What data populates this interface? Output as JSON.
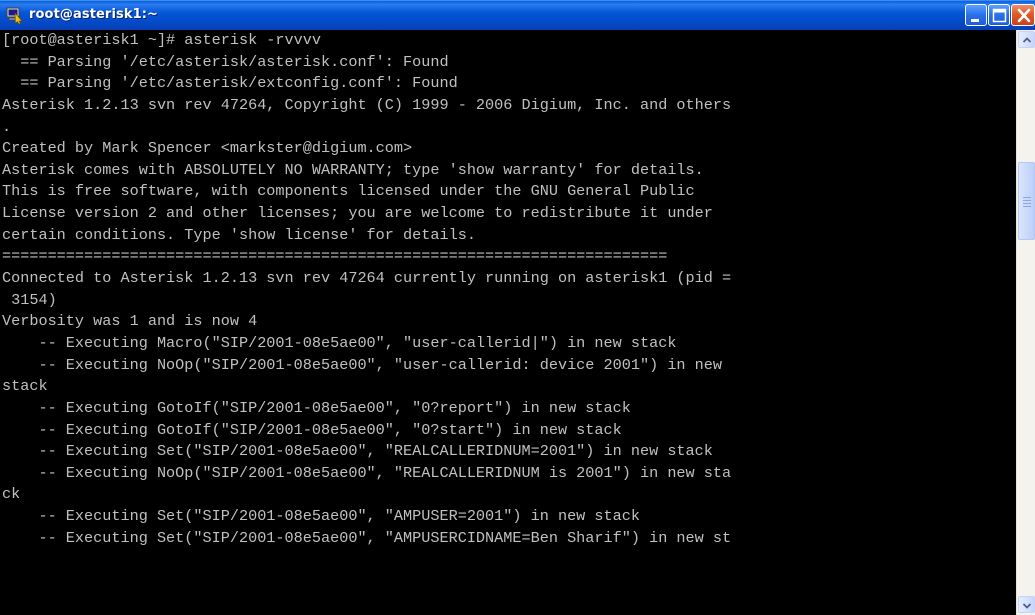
{
  "window": {
    "title": "root@asterisk1:~"
  },
  "icons": {
    "app": "putty-icon",
    "minimize": "minimize-icon",
    "maximize": "maximize-icon",
    "close": "close-icon",
    "scroll_up": "chevron-up-icon",
    "scroll_down": "chevron-down-icon"
  },
  "colors": {
    "terminal_bg": "#000000",
    "terminal_fg": "#c0c0c0",
    "titlebar": "#0556d6"
  },
  "terminal": {
    "lines": [
      "[root@asterisk1 ~]# asterisk -rvvvv",
      "  == Parsing '/etc/asterisk/asterisk.conf': Found",
      "  == Parsing '/etc/asterisk/extconfig.conf': Found",
      "Asterisk 1.2.13 svn rev 47264, Copyright (C) 1999 - 2006 Digium, Inc. and others",
      ".",
      "Created by Mark Spencer <markster@digium.com>",
      "Asterisk comes with ABSOLUTELY NO WARRANTY; type 'show warranty' for details.",
      "This is free software, with components licensed under the GNU General Public",
      "License version 2 and other licenses; you are welcome to redistribute it under",
      "certain conditions. Type 'show license' for details.",
      "=========================================================================",
      "Connected to Asterisk 1.2.13 svn rev 47264 currently running on asterisk1 (pid =",
      " 3154)",
      "Verbosity was 1 and is now 4",
      "    -- Executing Macro(\"SIP/2001-08e5ae00\", \"user-callerid|\") in new stack",
      "    -- Executing NoOp(\"SIP/2001-08e5ae00\", \"user-callerid: device 2001\") in new",
      "stack",
      "    -- Executing GotoIf(\"SIP/2001-08e5ae00\", \"0?report\") in new stack",
      "    -- Executing GotoIf(\"SIP/2001-08e5ae00\", \"0?start\") in new stack",
      "    -- Executing Set(\"SIP/2001-08e5ae00\", \"REALCALLERIDNUM=2001\") in new stack",
      "    -- Executing NoOp(\"SIP/2001-08e5ae00\", \"REALCALLERIDNUM is 2001\") in new sta",
      "ck",
      "    -- Executing Set(\"SIP/2001-08e5ae00\", \"AMPUSER=2001\") in new stack",
      "    -- Executing Set(\"SIP/2001-08e5ae00\", \"AMPUSERCIDNAME=Ben Sharif\") in new st"
    ]
  }
}
